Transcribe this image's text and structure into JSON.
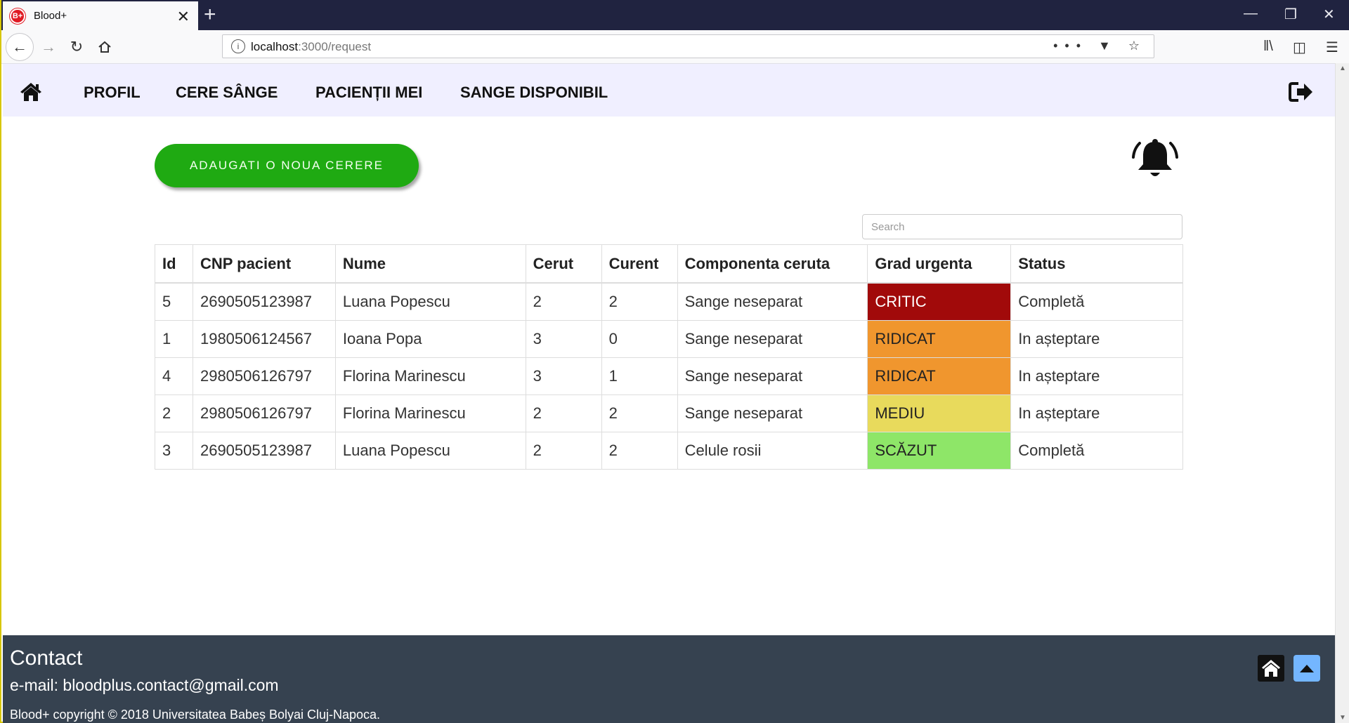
{
  "browser": {
    "tab_title": "Blood+",
    "favicon_text": "B+",
    "tab_close": "✕",
    "new_tab": "+",
    "url_host": "localhost",
    "url_path": ":3000/request",
    "url_actions": "•••",
    "icons": [
      "back-arrow-icon",
      "forward-arrow-icon",
      "reload-icon",
      "home-icon",
      "info-icon",
      "pocket-icon",
      "bookmark-star-icon",
      "library-icon",
      "sidebar-icon",
      "menu-icon"
    ]
  },
  "nav": {
    "items": [
      {
        "label": "PROFIL"
      },
      {
        "label": "CERE SÂNGE"
      },
      {
        "label": "PACIENȚII MEI"
      },
      {
        "label": "SANGE DISPONIBIL"
      }
    ]
  },
  "main": {
    "add_button": "ADAUGATI O NOUA CERERE",
    "search_placeholder": "Search"
  },
  "table": {
    "headers": [
      "Id",
      "CNP pacient",
      "Nume",
      "Cerut",
      "Curent",
      "Componenta ceruta",
      "Grad urgenta",
      "Status"
    ],
    "rows": [
      {
        "id": "5",
        "cnp": "2690505123987",
        "nume": "Luana Popescu",
        "cerut": "2",
        "curent": "2",
        "componenta": "Sange neseparat",
        "grad": "CRITIC",
        "status": "Completă"
      },
      {
        "id": "1",
        "cnp": "1980506124567",
        "nume": "Ioana Popa",
        "cerut": "3",
        "curent": "0",
        "componenta": "Sange neseparat",
        "grad": "RIDICAT",
        "status": "In așteptare"
      },
      {
        "id": "4",
        "cnp": "2980506126797",
        "nume": "Florina Marinescu",
        "cerut": "3",
        "curent": "1",
        "componenta": "Sange neseparat",
        "grad": "RIDICAT",
        "status": "In așteptare"
      },
      {
        "id": "2",
        "cnp": "2980506126797",
        "nume": "Florina Marinescu",
        "cerut": "2",
        "curent": "2",
        "componenta": "Sange neseparat",
        "grad": "MEDIU",
        "status": "In așteptare"
      },
      {
        "id": "3",
        "cnp": "2690505123987",
        "nume": "Luana Popescu",
        "cerut": "2",
        "curent": "2",
        "componenta": "Celule rosii",
        "grad": "SCĂZUT",
        "status": "Completă"
      }
    ]
  },
  "urgency_colors": {
    "CRITIC": {
      "bg": "#a10a0a",
      "fg": "#ffffff"
    },
    "RIDICAT": {
      "bg": "#f0962e",
      "fg": "#222222"
    },
    "MEDIU": {
      "bg": "#e8da5c",
      "fg": "#222222"
    },
    "SCĂZUT": {
      "bg": "#8ee668",
      "fg": "#222222"
    }
  },
  "footer": {
    "contact_title": "Contact",
    "email": "e-mail: bloodplus.contact@gmail.com",
    "copyright": "Blood+ copyright © 2018 Universitatea Babeș Bolyai Cluj-Napoca."
  },
  "colors": {
    "accent_green": "#1faa12",
    "nav_bg": "#f0efff",
    "footer_bg": "#364250",
    "tabstrip_bg": "#202340"
  }
}
